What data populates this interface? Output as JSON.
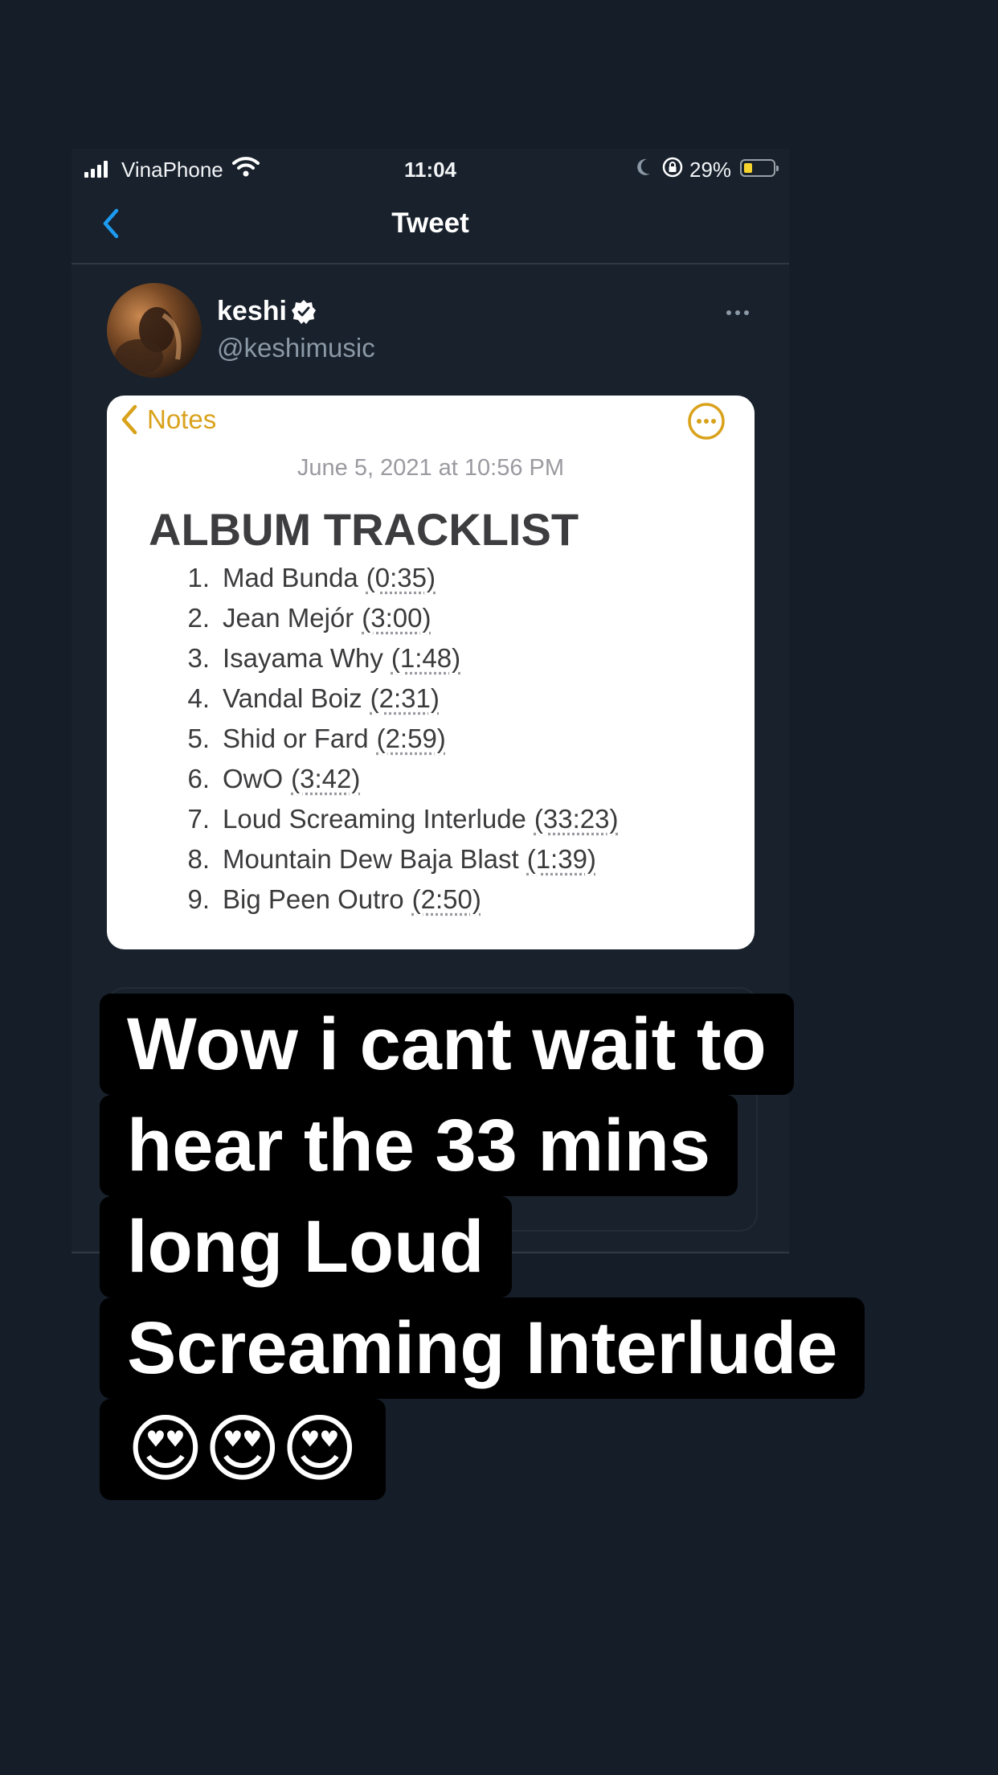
{
  "status_bar": {
    "carrier": "VinaPhone",
    "time": "11:04",
    "battery_percent": "29%",
    "battery_level": 0.29
  },
  "nav": {
    "title": "Tweet"
  },
  "tweet": {
    "author_name": "keshi",
    "author_handle": "@keshimusic",
    "verified": true
  },
  "note": {
    "back_label": "Notes",
    "date": "June 5, 2021 at 10:56 PM",
    "heading": "ALBUM TRACKLIST",
    "tracks": [
      {
        "num": "1.",
        "title": "Mad Bunda",
        "duration": "(0:35)"
      },
      {
        "num": "2.",
        "title": "Jean Mejór",
        "duration": "(3:00)"
      },
      {
        "num": "3.",
        "title": "Isayama Why",
        "duration": "(1:48)"
      },
      {
        "num": "4.",
        "title": "Vandal Boiz",
        "duration": "(2:31)"
      },
      {
        "num": "5.",
        "title": "Shid or Fard",
        "duration": "(2:59)"
      },
      {
        "num": "6.",
        "title": "OwO",
        "duration": "(3:42)"
      },
      {
        "num": "7.",
        "title": "Loud Screaming Interlude",
        "duration": "(33:23)"
      },
      {
        "num": "8.",
        "title": "Mountain Dew Baja Blast",
        "duration": "(1:39)"
      },
      {
        "num": "9.",
        "title": "Big Peen Outro",
        "duration": "(2:50)"
      }
    ]
  },
  "caption": {
    "lines": [
      "Wow i cant wait to",
      "hear the 33 mins",
      "long Loud",
      "Screaming Interlude"
    ],
    "emoji": "😍😍😍"
  },
  "colors": {
    "background": "#151d29",
    "accent_blue": "#1d9bf0",
    "notes_yellow": "#d9a21b",
    "verified_fill": "#ffffff"
  }
}
